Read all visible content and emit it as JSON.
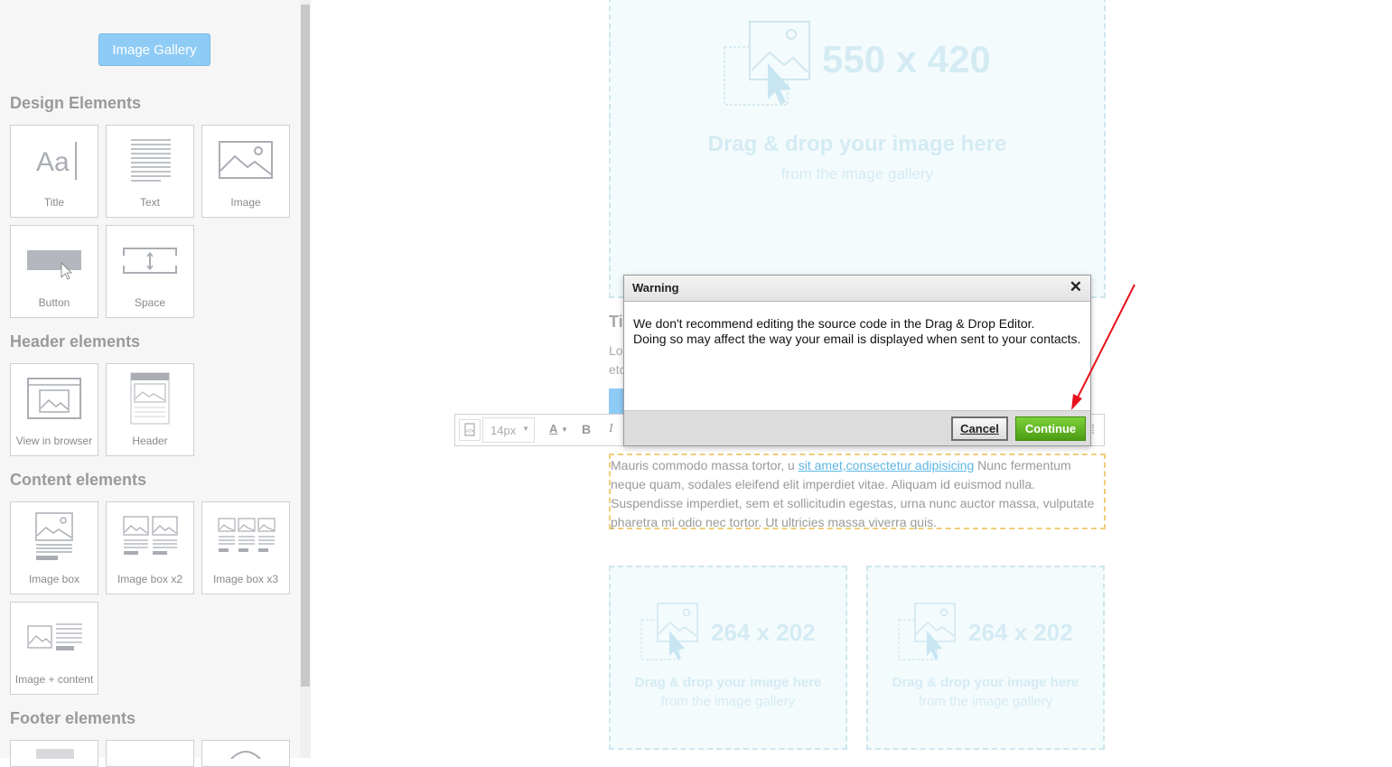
{
  "sidebar": {
    "gallery_button": "Image Gallery",
    "sections": {
      "design": "Design Elements",
      "header": "Header elements",
      "content": "Content elements",
      "footer": "Footer elements"
    },
    "design_tiles": [
      "Title",
      "Text",
      "Image",
      "Button",
      "Space"
    ],
    "header_tiles": [
      "View in browser",
      "Header"
    ],
    "content_tiles": [
      "Image box",
      "Image box x2",
      "Image box x3",
      "Image + content"
    ]
  },
  "canvas": {
    "hero": {
      "dimensions": "550 x 420",
      "drag_text": "Drag & drop your image here",
      "from_text": "from the image gallery"
    },
    "behind_modal": {
      "title_fragment": "Ti",
      "line1_fragment": "Lo",
      "line2_fragment": "etc"
    },
    "text_block": {
      "before_link": "Mauris commodo massa tortor, u ",
      "link1": "sit amet,",
      "link2": "consectetur adipisicing",
      "after_link": " Nunc fermentum neque quam, sodales eleifend elit imperdiet vitae. Aliquam id euismod nulla. Suspendisse imperdiet, sem et sollicitudin egestas, urna nunc auctor massa, vulputate pharetra mi odio nec tortor. Ut ultricies massa viverra quis."
    },
    "small_left": {
      "dimensions": "264 x 202",
      "drag_text": "Drag & drop your image here",
      "from_text": "from the image gallery"
    },
    "small_right": {
      "dimensions": "264 x 202",
      "drag_text": "Drag & drop your image here",
      "from_text": "from the image gallery"
    }
  },
  "toolbar": {
    "font_size": "14px",
    "text_color_glyph": "A",
    "bold_glyph": "B",
    "italic_glyph": "I"
  },
  "modal": {
    "title": "Warning",
    "close_glyph": "✕",
    "line1": "We don't recommend editing the source code in the Drag & Drop Editor.",
    "line2": "Doing so may affect the way your email is displayed when sent to your contacts.",
    "cancel_label": "Cancel",
    "continue_label": "Continue"
  },
  "colors": {
    "gallery_button": "#8ecbf5",
    "continue_button": "#5fb01f",
    "annotation_arrow": "#e8121b",
    "selected_border": "#f1cd7a"
  }
}
